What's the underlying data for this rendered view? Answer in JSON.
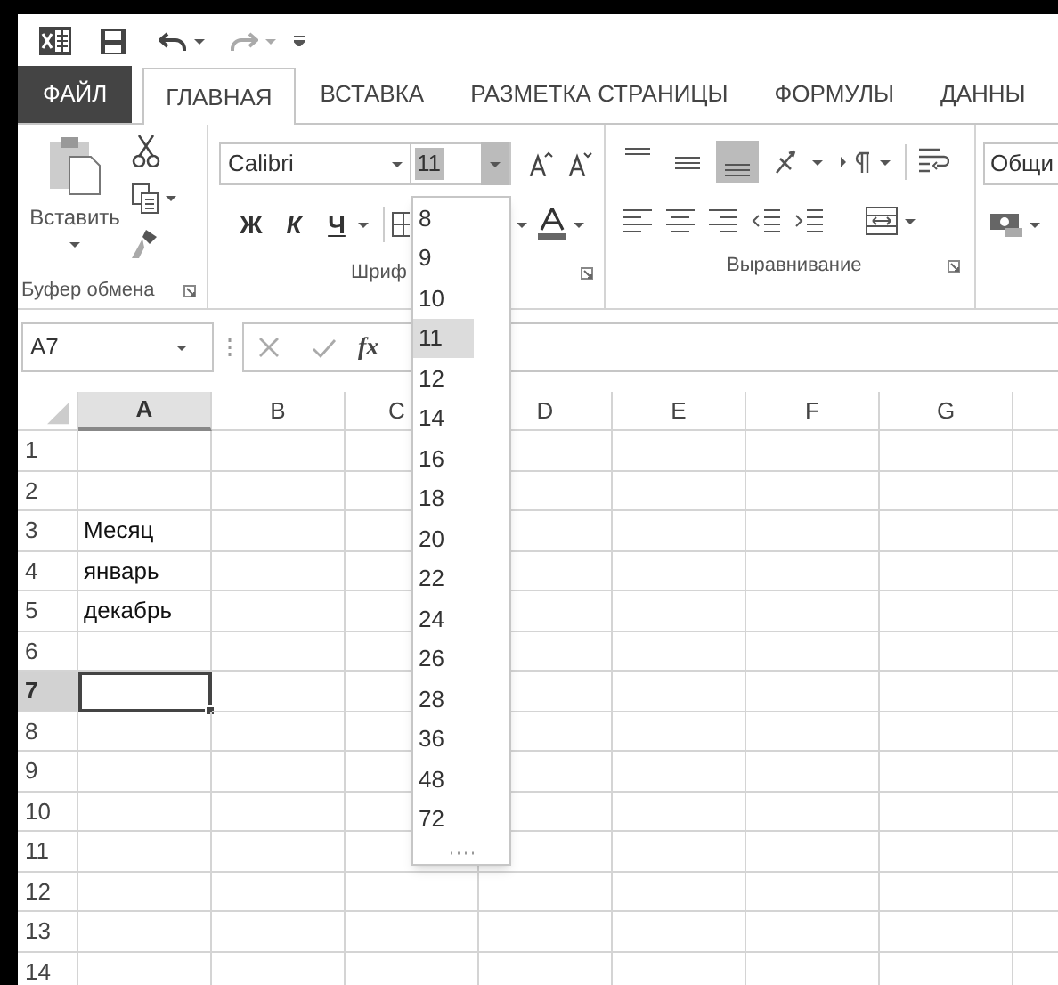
{
  "tabs": [
    {
      "label": "ФАЙЛ",
      "kind": "file",
      "selected": false
    },
    {
      "label": "ГЛАВНАЯ",
      "kind": "tab",
      "selected": true
    },
    {
      "label": "ВСТАВКА",
      "kind": "tab",
      "selected": false
    },
    {
      "label": "РАЗМЕТКА СТРАНИЦЫ",
      "kind": "tab",
      "selected": false
    },
    {
      "label": "ФОРМУЛЫ",
      "kind": "tab",
      "selected": false
    },
    {
      "label": "ДАННЫ",
      "kind": "tab",
      "selected": false
    }
  ],
  "ribbon": {
    "clipboard": {
      "paste_label": "Вставить",
      "group_label": "Буфер обмена"
    },
    "font": {
      "font_name": "Calibri",
      "font_size": "11",
      "bold": "Ж",
      "italic": "К",
      "underline": "Ч",
      "group_label": "Шриф"
    },
    "alignment": {
      "group_label": "Выравнивание",
      "vertical_align": [
        {
          "kind": "top",
          "selected": false
        },
        {
          "kind": "middle",
          "selected": false
        },
        {
          "kind": "bottom",
          "selected": true
        }
      ]
    },
    "number": {
      "format": "Общи"
    }
  },
  "formula_bar": {
    "name_box": "A7",
    "fx": "fx"
  },
  "sheet": {
    "columns": [
      {
        "label": "A",
        "selected": true,
        "kind": "normal"
      },
      {
        "label": "B",
        "selected": false,
        "kind": "normal"
      },
      {
        "label": "C",
        "selected": false,
        "kind": "covered"
      },
      {
        "label": "D",
        "selected": false,
        "kind": "normal"
      },
      {
        "label": "E",
        "selected": false,
        "kind": "normal"
      },
      {
        "label": "F",
        "selected": false,
        "kind": "normal"
      },
      {
        "label": "G",
        "selected": false,
        "kind": "normal"
      }
    ],
    "rows": [
      {
        "label": "1",
        "selected": false
      },
      {
        "label": "2",
        "selected": false
      },
      {
        "label": "3",
        "selected": false,
        "a": "Месяц"
      },
      {
        "label": "4",
        "selected": false,
        "a": "январь"
      },
      {
        "label": "5",
        "selected": false,
        "a": "декабрь"
      },
      {
        "label": "6",
        "selected": false
      },
      {
        "label": "7",
        "selected": true
      },
      {
        "label": "8",
        "selected": false
      },
      {
        "label": "9",
        "selected": false
      },
      {
        "label": "10",
        "selected": false
      },
      {
        "label": "11",
        "selected": false
      },
      {
        "label": "12",
        "selected": false
      },
      {
        "label": "13",
        "selected": false
      },
      {
        "label": "14",
        "selected": false
      }
    ]
  },
  "font_size_menu": {
    "items": [
      {
        "label": "8",
        "selected": false
      },
      {
        "label": "9",
        "selected": false
      },
      {
        "label": "10",
        "selected": false
      },
      {
        "label": "11",
        "selected": true
      },
      {
        "label": "12",
        "selected": false
      },
      {
        "label": "14",
        "selected": false
      },
      {
        "label": "16",
        "selected": false
      },
      {
        "label": "18",
        "selected": false
      },
      {
        "label": "20",
        "selected": false
      },
      {
        "label": "22",
        "selected": false
      },
      {
        "label": "24",
        "selected": false
      },
      {
        "label": "26",
        "selected": false
      },
      {
        "label": "28",
        "selected": false
      },
      {
        "label": "36",
        "selected": false
      },
      {
        "label": "48",
        "selected": false
      },
      {
        "label": "72",
        "selected": false
      }
    ]
  }
}
